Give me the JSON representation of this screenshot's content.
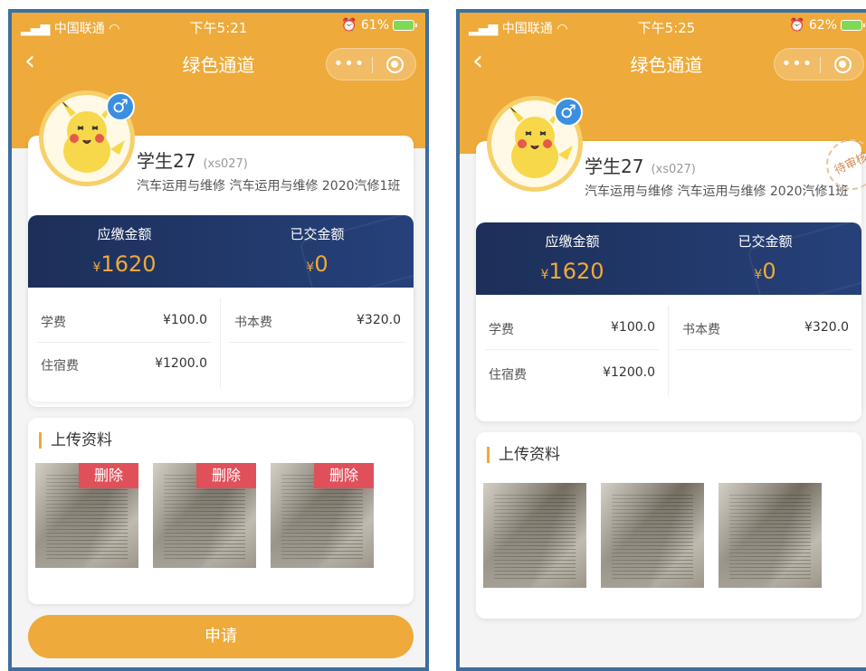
{
  "colors": {
    "accent": "#eeaa3a",
    "navy": "#1d2f59",
    "delete": "#e0505a",
    "border": "#3e6e9e"
  },
  "screens": [
    {
      "status": {
        "carrier": "中国联通",
        "time": "下午5:21",
        "battery": "61%"
      },
      "title": "绿色通道",
      "student": {
        "name": "学生27",
        "id": "(xs027)",
        "major": "汽车运用与维修 汽车运用与维修 2020汽修1班"
      },
      "summary": {
        "due_label": "应缴金额",
        "due_value": "1620",
        "paid_label": "已交金额",
        "paid_value": "0",
        "currency": "¥"
      },
      "fees": [
        {
          "name": "学费",
          "value": "¥100.0"
        },
        {
          "name": "书本费",
          "value": "¥320.0"
        },
        {
          "name": "住宿费",
          "value": "¥1200.0"
        }
      ],
      "upload_title": "上传资料",
      "delete_label": "删除",
      "submit_label": "申请"
    },
    {
      "status": {
        "carrier": "中国联通",
        "time": "下午5:25",
        "battery": "62%"
      },
      "title": "绿色通道",
      "student": {
        "name": "学生27",
        "id": "(xs027)",
        "major": "汽车运用与维修 汽车运用与维修 2020汽修1班"
      },
      "stamp": "待审核",
      "summary": {
        "due_label": "应缴金额",
        "due_value": "1620",
        "paid_label": "已交金额",
        "paid_value": "0",
        "currency": "¥"
      },
      "fees": [
        {
          "name": "学费",
          "value": "¥100.0"
        },
        {
          "name": "书本费",
          "value": "¥320.0"
        },
        {
          "name": "住宿费",
          "value": "¥1200.0"
        }
      ],
      "upload_title": "上传资料"
    }
  ]
}
